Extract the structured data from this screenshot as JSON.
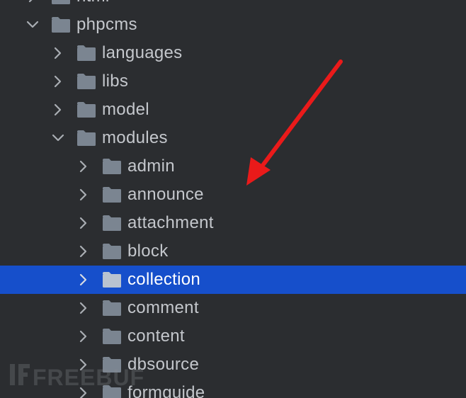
{
  "colors": {
    "background": "#2b2d30",
    "selection": "#164fcb",
    "folder": "#7b8591",
    "folder_selected": "#b9c3d0",
    "text": "#c4c7cc",
    "text_selected": "#ffffff",
    "annotation_arrow": "#ea1a1a"
  },
  "tree": {
    "items": [
      {
        "label": "html",
        "depth": 1,
        "expanded": false,
        "selected": false,
        "partial": true
      },
      {
        "label": "phpcms",
        "depth": 1,
        "expanded": true,
        "selected": false
      },
      {
        "label": "languages",
        "depth": 2,
        "expanded": false,
        "selected": false
      },
      {
        "label": "libs",
        "depth": 2,
        "expanded": false,
        "selected": false
      },
      {
        "label": "model",
        "depth": 2,
        "expanded": false,
        "selected": false
      },
      {
        "label": "modules",
        "depth": 2,
        "expanded": true,
        "selected": false
      },
      {
        "label": "admin",
        "depth": 3,
        "expanded": false,
        "selected": false
      },
      {
        "label": "announce",
        "depth": 3,
        "expanded": false,
        "selected": false
      },
      {
        "label": "attachment",
        "depth": 3,
        "expanded": false,
        "selected": false
      },
      {
        "label": "block",
        "depth": 3,
        "expanded": false,
        "selected": false
      },
      {
        "label": "collection",
        "depth": 3,
        "expanded": false,
        "selected": true
      },
      {
        "label": "comment",
        "depth": 3,
        "expanded": false,
        "selected": false
      },
      {
        "label": "content",
        "depth": 3,
        "expanded": false,
        "selected": false
      },
      {
        "label": "dbsource",
        "depth": 3,
        "expanded": false,
        "selected": false
      },
      {
        "label": "formguide",
        "depth": 3,
        "expanded": false,
        "selected": false
      }
    ]
  },
  "watermark": {
    "text": "FREEBUF"
  },
  "icons": {
    "folder": "folder-icon",
    "expanded": "chevron-down-icon",
    "collapsed": "chevron-right-icon",
    "annotation": "red-arrow-icon"
  }
}
